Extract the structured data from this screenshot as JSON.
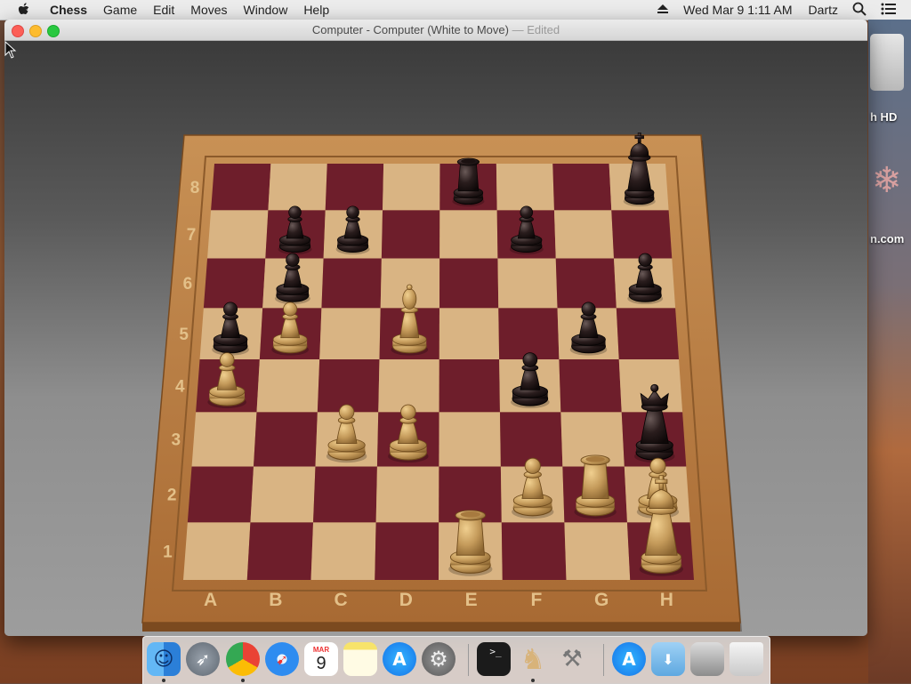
{
  "menubar": {
    "app_name": "Chess",
    "items": [
      "Game",
      "Edit",
      "Moves",
      "Window",
      "Help"
    ],
    "user": "Dartz",
    "clock": "Wed Mar 9  1:11 AM"
  },
  "desktop": {
    "label_hd": "h HD",
    "label_com": "n.com"
  },
  "window": {
    "title": "Computer - Computer   (White to Move)",
    "edited": " — Edited"
  },
  "board": {
    "files": [
      "A",
      "B",
      "C",
      "D",
      "E",
      "F",
      "G",
      "H"
    ],
    "ranks": [
      "1",
      "2",
      "3",
      "4",
      "5",
      "6",
      "7",
      "8"
    ],
    "light_square": "#d9b483",
    "dark_square": "#6e1e2b",
    "frame_color": "#b77a3e"
  },
  "pieces": [
    {
      "color": "black",
      "type": "rook",
      "square": "e8"
    },
    {
      "color": "black",
      "type": "king",
      "square": "h8"
    },
    {
      "color": "black",
      "type": "pawn",
      "square": "b7"
    },
    {
      "color": "black",
      "type": "pawn",
      "square": "c7"
    },
    {
      "color": "black",
      "type": "pawn",
      "square": "f7"
    },
    {
      "color": "black",
      "type": "pawn",
      "square": "b6"
    },
    {
      "color": "black",
      "type": "pawn",
      "square": "h6"
    },
    {
      "color": "black",
      "type": "pawn",
      "square": "a5"
    },
    {
      "color": "black",
      "type": "pawn",
      "square": "g5"
    },
    {
      "color": "black",
      "type": "pawn",
      "square": "f4"
    },
    {
      "color": "black",
      "type": "queen",
      "square": "h3"
    },
    {
      "color": "white",
      "type": "pawn",
      "square": "b5"
    },
    {
      "color": "white",
      "type": "bishop",
      "square": "d5"
    },
    {
      "color": "white",
      "type": "pawn",
      "square": "a4"
    },
    {
      "color": "white",
      "type": "pawn",
      "square": "c3"
    },
    {
      "color": "white",
      "type": "pawn",
      "square": "d3"
    },
    {
      "color": "white",
      "type": "pawn",
      "square": "f2"
    },
    {
      "color": "white",
      "type": "rook",
      "square": "g2"
    },
    {
      "color": "white",
      "type": "pawn",
      "square": "h2"
    },
    {
      "color": "white",
      "type": "rook",
      "square": "e1"
    },
    {
      "color": "white",
      "type": "king",
      "square": "h1"
    }
  ],
  "dock": {
    "items": [
      {
        "name": "finder-icon",
        "running": true
      },
      {
        "name": "launchpad-icon",
        "running": false
      },
      {
        "name": "chrome-icon",
        "running": true
      },
      {
        "name": "safari-icon",
        "running": false
      },
      {
        "name": "calendar-icon",
        "running": false,
        "month": "MAR",
        "day": "9"
      },
      {
        "name": "notes-icon",
        "running": false
      },
      {
        "name": "app-store-icon",
        "running": false
      },
      {
        "name": "system-preferences-icon",
        "running": false
      },
      {
        "name": "terminal-icon",
        "running": false,
        "prompt": ">_"
      },
      {
        "name": "chess-icon",
        "running": true
      },
      {
        "name": "xcode-tools-icon",
        "running": false
      },
      {
        "name": "app-store-alt-icon",
        "running": false
      },
      {
        "name": "downloads-folder-icon",
        "running": false
      },
      {
        "name": "photos-stack-icon",
        "running": false
      },
      {
        "name": "trash-icon",
        "running": false
      }
    ]
  }
}
